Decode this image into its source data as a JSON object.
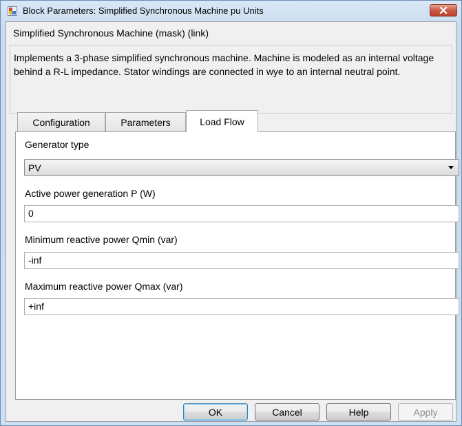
{
  "window": {
    "title": "Block Parameters: Simplified Synchronous Machine pu Units",
    "close_icon": "close-icon"
  },
  "block": {
    "name": "Simplified Synchronous Machine (mask) (link)",
    "description": "Implements a 3-phase simplified synchronous machine. Machine is modeled as an internal voltage behind a R-L impedance. Stator windings are connected in wye to an internal neutral point."
  },
  "tabs": [
    {
      "label": "Configuration",
      "active": false
    },
    {
      "label": "Parameters",
      "active": false
    },
    {
      "label": "Load Flow",
      "active": true
    }
  ],
  "load_flow": {
    "generator_type_label": "Generator type",
    "generator_type_value": "PV",
    "active_power_label": "Active power generation P (W)",
    "active_power_value": "0",
    "qmin_label": "Minimum reactive power Qmin (var)",
    "qmin_value": "-inf",
    "qmax_label": "Maximum reactive power Qmax (var)",
    "qmax_value": "+inf"
  },
  "buttons": {
    "ok": "OK",
    "cancel": "Cancel",
    "help": "Help",
    "apply": "Apply"
  }
}
